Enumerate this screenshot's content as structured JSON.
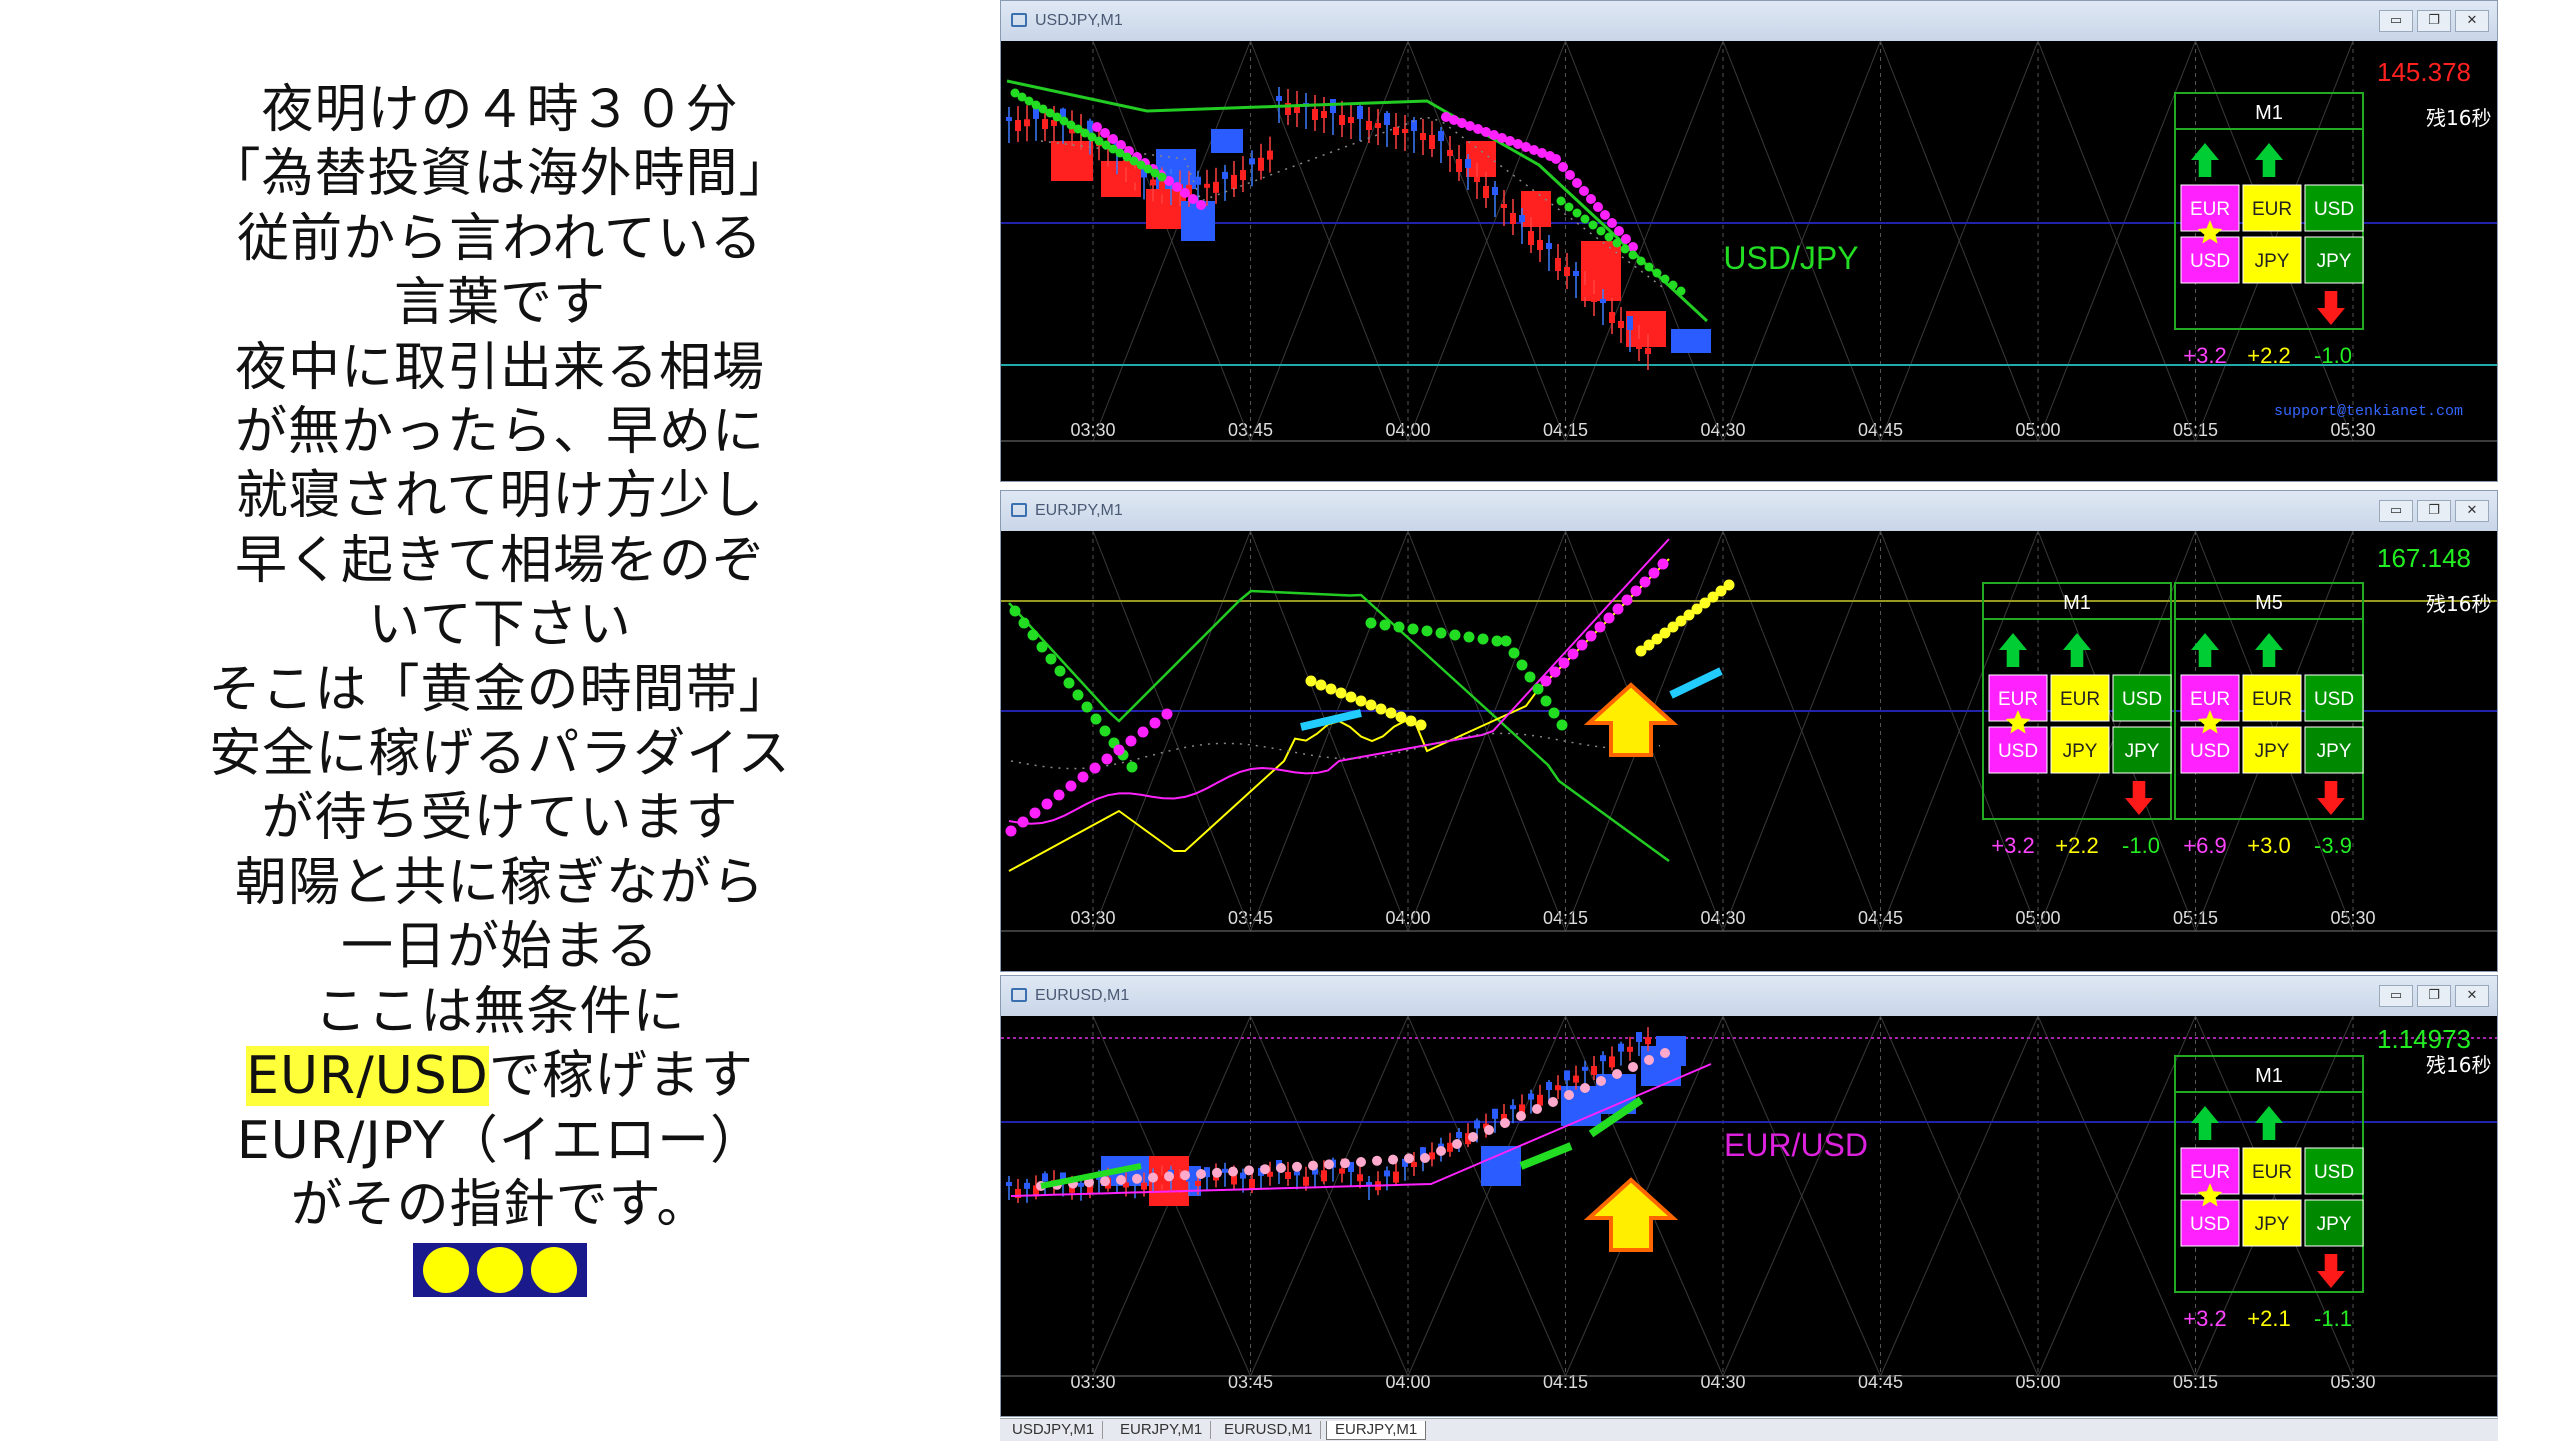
{
  "left_text": {
    "lines": [
      "夜明けの４時３０分",
      "「為替投資は海外時間」",
      "従前から言われている",
      "言葉です",
      "夜中に取引出来る相場",
      "が無かったら、早めに",
      "就寝されて明け方少し",
      "早く起きて相場をのぞ",
      "いて下さい",
      "そこは「黄金の時間帯」",
      "安全に稼げるパラダイス",
      "が待ち受けています",
      "朝陽と共に稼ぎながら",
      "一日が始まる",
      "ここは無条件に"
    ],
    "highlight": "EUR/USD",
    "highlight_suffix": "で稼げます",
    "line_eurjpy": "EUR/JPY（イエロー）",
    "line_last": "がその指針です。"
  },
  "time_labels": [
    "03:30",
    "03:45",
    "04:00",
    "04:15",
    "04:30",
    "04:45",
    "05:00",
    "05:15",
    "05:30"
  ],
  "windows": [
    {
      "title": "USDJPY,M1",
      "price": "145.378",
      "price_color": "#ff2020",
      "pair_label": "USD/JPY",
      "pair_color": "#22dd22",
      "remaining": "残16秒",
      "support": "support@tenkianet.com",
      "panels": [
        {
          "tf": "M1",
          "vals": [
            "+3.2",
            "+2.2",
            "-1.0"
          ]
        }
      ]
    },
    {
      "title": "EURJPY,M1",
      "price": "167.148",
      "price_color": "#22ee22",
      "pair_label": "",
      "pair_color": "",
      "remaining": "残16秒",
      "support": "",
      "panels": [
        {
          "tf": "M1",
          "vals": [
            "+3.2",
            "+2.2",
            "-1.0"
          ]
        },
        {
          "tf": "M5",
          "vals": [
            "+6.9",
            "+3.0",
            "-3.9"
          ]
        }
      ]
    },
    {
      "title": "EURUSD,M1",
      "price": "1.14973",
      "price_color": "#22ee22",
      "pair_label": "EUR/USD",
      "pair_color": "#dd22dd",
      "remaining": "残16秒",
      "support": "",
      "panels": [
        {
          "tf": "M1",
          "vals": [
            "+3.2",
            "+2.1",
            "-1.1"
          ]
        }
      ]
    }
  ],
  "currency": {
    "row1": [
      "EUR",
      "EUR",
      "USD"
    ],
    "row2": [
      "USD",
      "JPY",
      "JPY"
    ]
  },
  "colors": {
    "magenta": "#ff22ff",
    "yellow": "#ffff00",
    "green": "#009900",
    "up": "#00cc33",
    "down": "#ff1a1a",
    "chart_bg": "#000000",
    "grid": "#3a3a3a"
  },
  "icons": {
    "up": "green-up-arrow-icon",
    "down": "red-down-arrow-icon",
    "star": "star-icon",
    "signal": "yellow-up-arrow-icon"
  },
  "tabs": [
    "USDJPY,M1",
    "EURJPY,M1",
    "EURUSD,M1",
    "EURJPY,M1"
  ],
  "active_tab": 3,
  "window_buttons": {
    "minimize": "▭",
    "restore": "❐",
    "close": "✕"
  }
}
